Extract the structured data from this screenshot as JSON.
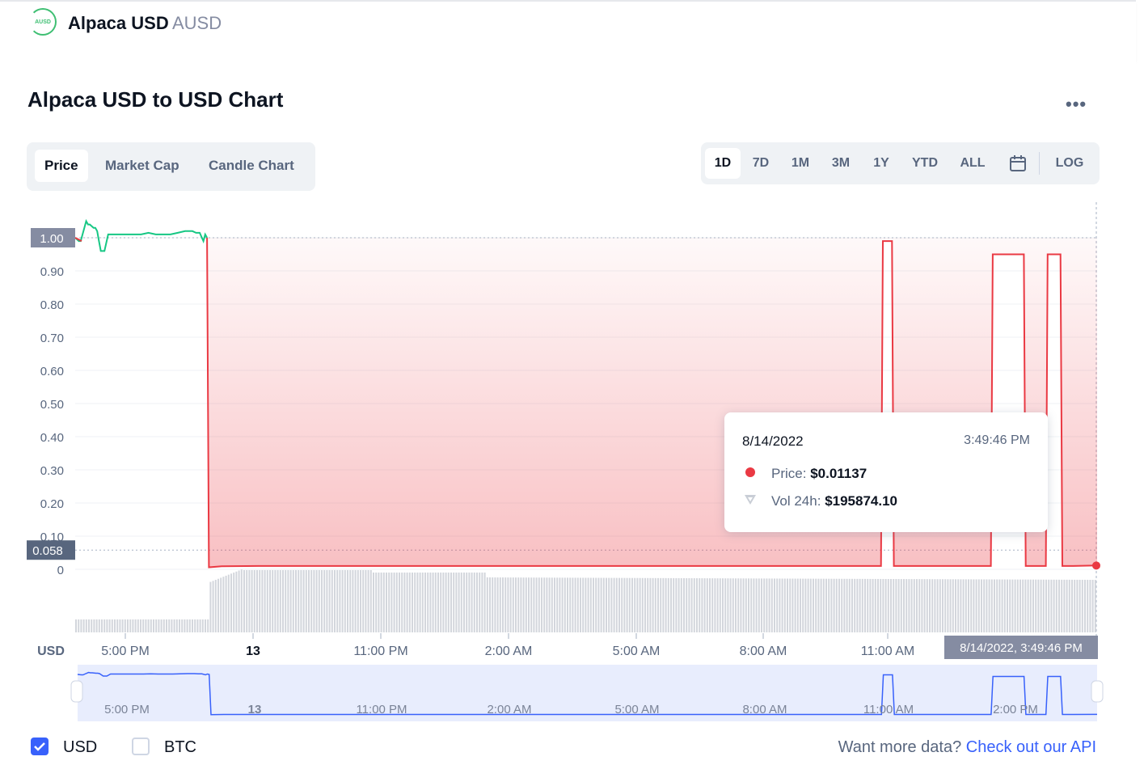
{
  "header": {
    "logo_text": "AUSD",
    "coin_name": "Alpaca USD",
    "coin_symbol": "AUSD"
  },
  "page": {
    "title": "Alpaca USD to USD Chart",
    "more_icon": "more-horizontal-icon"
  },
  "tabs": [
    {
      "label": "Price",
      "active": true
    },
    {
      "label": "Market Cap",
      "active": false
    },
    {
      "label": "Candle Chart",
      "active": false
    }
  ],
  "ranges": [
    {
      "label": "1D",
      "active": true
    },
    {
      "label": "7D",
      "active": false
    },
    {
      "label": "1M",
      "active": false
    },
    {
      "label": "3M",
      "active": false
    },
    {
      "label": "1Y",
      "active": false
    },
    {
      "label": "YTD",
      "active": false
    },
    {
      "label": "ALL",
      "active": false
    }
  ],
  "calendar_icon": "calendar-icon",
  "log_label": "LOG",
  "tooltip": {
    "date": "8/14/2022",
    "time": "3:49:46 PM",
    "price_label": "Price:",
    "price_value": "$0.01137",
    "vol_label": "Vol 24h:",
    "vol_value": "$195874.10"
  },
  "chart_data": {
    "type": "line",
    "xlabel": "",
    "ylabel": "USD",
    "y_ticks": [
      "1.00",
      "0.90",
      "0.80",
      "0.70",
      "0.60",
      "0.50",
      "0.40",
      "0.30",
      "0.20",
      "0.10",
      "0"
    ],
    "ylim": [
      0,
      1.0
    ],
    "x_ticks": [
      "5:00 PM",
      "13",
      "11:00 PM",
      "2:00 AM",
      "5:00 AM",
      "8:00 AM",
      "11:00 AM"
    ],
    "price_marker_top": "1.00",
    "price_marker_current": "0.058",
    "crosshair_label": "8/14/2022, 3:49:46 PM",
    "colors": {
      "up": "#16c784",
      "down": "#ea3943",
      "volume": "#d3d6dc",
      "navigator": "#3861fb"
    },
    "series": [
      {
        "x": [
          0,
          0.1,
          0.15,
          0.2,
          0.3,
          0.35,
          0.4,
          0.5,
          0.55,
          0.6,
          0.65,
          0.7,
          0.8,
          0.9,
          1.0,
          1.2,
          1.4,
          1.6,
          1.8,
          2.0,
          2.2,
          2.4,
          2.6,
          2.8,
          3.0,
          3.2,
          3.3,
          3.4,
          3.5,
          3.55,
          3.6,
          3.65,
          4.0,
          5,
          6,
          7,
          8,
          9,
          10,
          11,
          12,
          13,
          14,
          15,
          16,
          17,
          18,
          19,
          20,
          21,
          22,
          22.05,
          22.3,
          22.35,
          23,
          24,
          25,
          25.05,
          25.9,
          25.95,
          26.5,
          26.55,
          26.9,
          26.95,
          27.2,
          27.25,
          27.9
        ],
        "values": [
          1.0,
          0.99,
          0.99,
          1.01,
          1.05,
          1.04,
          1.04,
          1.03,
          1.03,
          1.02,
          0.99,
          0.96,
          0.96,
          1.01,
          1.01,
          1.01,
          1.01,
          1.01,
          1.01,
          1.015,
          1.01,
          1.01,
          1.01,
          1.015,
          1.02,
          1.02,
          1.015,
          1.015,
          0.99,
          1.01,
          1.0,
          0.006,
          0.009,
          0.01,
          0.01,
          0.01,
          0.01,
          0.01,
          0.01,
          0.01,
          0.01,
          0.01,
          0.01,
          0.01,
          0.01,
          0.01,
          0.01,
          0.01,
          0.01,
          0.01,
          0.01,
          0.99,
          0.99,
          0.01,
          0.01,
          0.01,
          0.01,
          0.95,
          0.95,
          0.01,
          0.01,
          0.95,
          0.95,
          0.01,
          0.01,
          0.01,
          0.01137
        ]
      }
    ]
  },
  "navigator": {
    "x_ticks": [
      "5:00 PM",
      "13",
      "11:00 PM",
      "2:00 AM",
      "5:00 AM",
      "8:00 AM",
      "11:00 AM",
      "2:00 PM"
    ]
  },
  "footer": {
    "usd_label": "USD",
    "usd_checked": true,
    "btc_label": "BTC",
    "btc_checked": false,
    "api_text": "Want more data?",
    "api_link": "Check out our API"
  }
}
